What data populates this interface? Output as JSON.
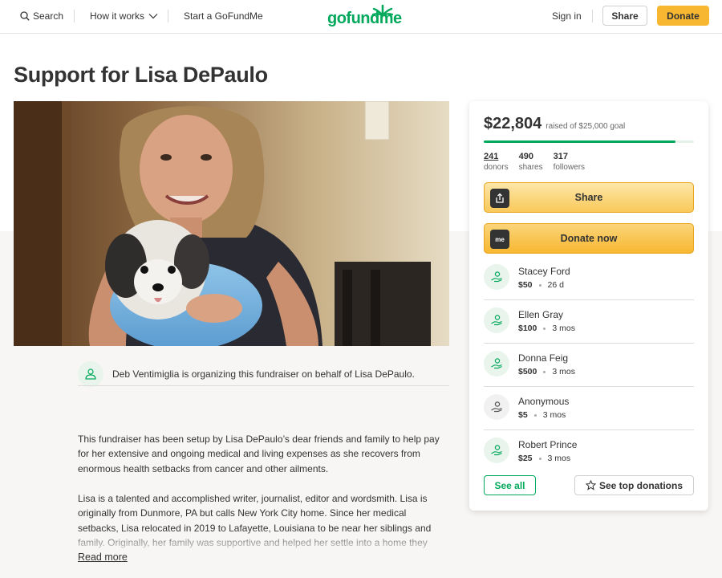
{
  "nav": {
    "search_label": "Search",
    "how_it_works_label": "How it works",
    "start_label": "Start a GoFundMe",
    "logo_text": "gofundme",
    "sign_in_label": "Sign in",
    "share_label": "Share",
    "donate_label": "Donate"
  },
  "campaign": {
    "title": "Support for Lisa DePaulo",
    "organizer_text": "Deb Ventimiglia is organizing this fundraiser on behalf of Lisa DePaulo.",
    "description_1": "This fundraiser has been setup by Lisa DePaulo’s dear friends and family to help pay for her extensive and ongoing medical and living expenses as she recovers from enormous health setbacks from cancer and other ailments.",
    "description_2": "Lisa is a talented and accomplished writer, journalist, editor and wordsmith. Lisa is originally from Dunmore, PA but calls New York City home. Since her medical setbacks, Lisa relocated in 2019 to Lafayette, Louisiana to be near her siblings and family. Originally, her family was supportive and helped her settle into a home they",
    "read_more_label": "Read more"
  },
  "sidebar": {
    "raised_amount": "$22,804",
    "raised_of_goal": "raised of $25,000 goal",
    "progress_fraction": 0.912,
    "stats": [
      {
        "number": "241",
        "label": "donors"
      },
      {
        "number": "490",
        "label": "shares"
      },
      {
        "number": "317",
        "label": "followers"
      }
    ],
    "share_button_label": "Share",
    "donate_button_label": "Donate now",
    "donate_icon_text": "me",
    "donations": [
      {
        "name": "Stacey Ford",
        "amount": "$50",
        "time": "26 d"
      },
      {
        "name": "Ellen Gray",
        "amount": "$100",
        "time": "3 mos"
      },
      {
        "name": "Donna Feig",
        "amount": "$500",
        "time": "3 mos"
      },
      {
        "name": "Anonymous",
        "amount": "$5",
        "time": "3 mos"
      },
      {
        "name": "Robert Prince",
        "amount": "$25",
        "time": "3 mos"
      }
    ],
    "see_all_label": "See all",
    "see_top_label": "See top donations"
  },
  "colors": {
    "brand_green": "#02a95c",
    "donate_yellow": "#f7b731"
  }
}
